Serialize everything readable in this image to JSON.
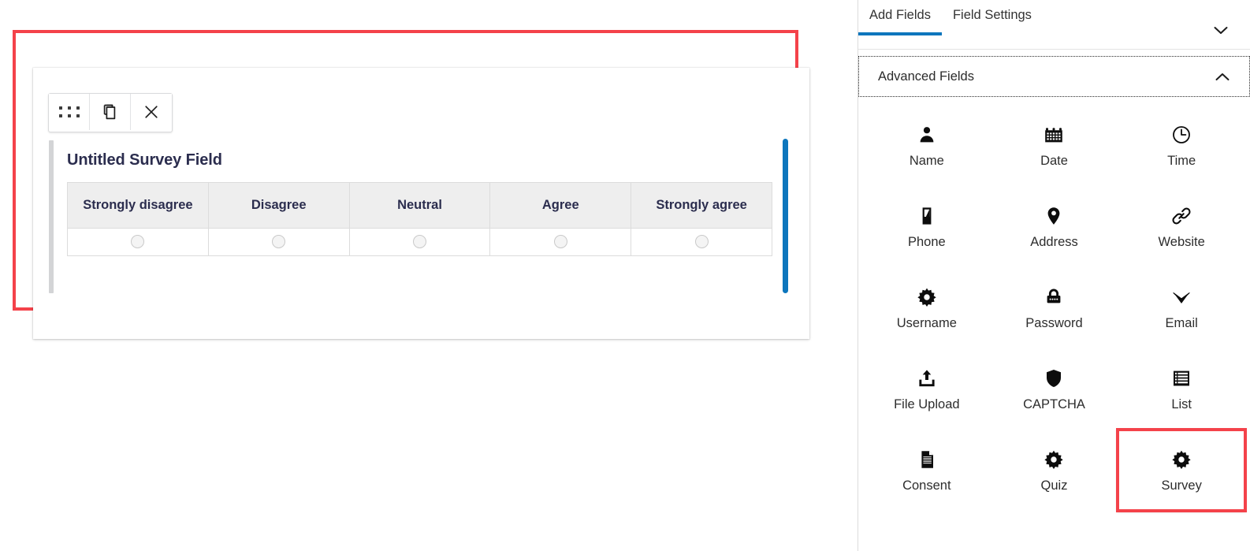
{
  "canvas": {
    "field": {
      "label": "Untitled Survey Field",
      "toolbar": {
        "drag_label": "",
        "duplicate_label": "",
        "delete_label": ""
      },
      "columns": [
        "Strongly disagree",
        "Disagree",
        "Neutral",
        "Agree",
        "Strongly agree"
      ],
      "rows": [
        {
          "options": [
            "",
            "",
            "",
            "",
            ""
          ]
        }
      ],
      "accent_color": "#0d76bd",
      "highlight_color": "#f4424a"
    }
  },
  "panel": {
    "tabs": [
      {
        "label": "Add Fields",
        "active": true
      },
      {
        "label": "Field Settings",
        "active": false
      }
    ],
    "collapse_icon": "chevron-down-icon",
    "sections": [
      {
        "title": "Advanced Fields",
        "expanded": true,
        "toggle_icon": "chevron-up-icon",
        "fields": [
          {
            "label": "Name",
            "icon": "person-icon",
            "highlighted": false
          },
          {
            "label": "Date",
            "icon": "calendar-icon",
            "highlighted": false
          },
          {
            "label": "Time",
            "icon": "clock-icon",
            "highlighted": false
          },
          {
            "label": "Phone",
            "icon": "phone-icon",
            "highlighted": false
          },
          {
            "label": "Address",
            "icon": "map-pin-icon",
            "highlighted": false
          },
          {
            "label": "Website",
            "icon": "link-icon",
            "highlighted": false
          },
          {
            "label": "Username",
            "icon": "gear-icon",
            "highlighted": false
          },
          {
            "label": "Password",
            "icon": "lock-icon",
            "highlighted": false
          },
          {
            "label": "Email",
            "icon": "envelope-icon",
            "highlighted": false
          },
          {
            "label": "File Upload",
            "icon": "upload-icon",
            "highlighted": false
          },
          {
            "label": "CAPTCHA",
            "icon": "shield-icon",
            "highlighted": false
          },
          {
            "label": "List",
            "icon": "list-icon",
            "highlighted": false
          },
          {
            "label": "Consent",
            "icon": "document-icon",
            "highlighted": false
          },
          {
            "label": "Quiz",
            "icon": "gear-icon",
            "highlighted": false
          },
          {
            "label": "Survey",
            "icon": "gear-icon",
            "highlighted": true
          }
        ]
      }
    ]
  }
}
